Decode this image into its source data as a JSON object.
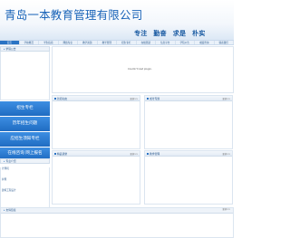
{
  "header": {
    "site_title": "青岛一本教育管理有限公司",
    "slogan": [
      "专注",
      "勤奋",
      "求是",
      "朴实"
    ]
  },
  "nav": {
    "items": [
      "首页",
      "学校概况",
      "学生指南",
      "网络专业",
      "教学资源",
      "教学管理",
      "招生专栏",
      "在线答疑",
      "信息平台",
      "学院公告",
      "成绩查询",
      "联系我们"
    ],
    "active_index": 0
  },
  "left": {
    "search_title": "学院公告",
    "buttons": [
      "招生专栏",
      "历年招生问题",
      "应招生须知专栏",
      "在线咨询   网上报名"
    ],
    "zone_title": "专业介绍",
    "zone_links": [
      "计算机",
      "",
      "护理",
      "",
      "建筑工程设计"
    ]
  },
  "main": {
    "notice_text": "Couldn't load plugin.",
    "boxes": [
      {
        "title": "新闻动态",
        "more": "更多>>"
      },
      {
        "title": "成考专题",
        "more": "更多>>"
      },
      {
        "title": "精品课堂",
        "more": "更多>>"
      },
      {
        "title": "教学管理",
        "more": "更多>>"
      }
    ]
  },
  "bottom": {
    "links_title": "友情链接",
    "more": "更多>>"
  },
  "colors": {
    "brand_blue": "#1a64b8",
    "button_blue": "#2a73c4",
    "border": "#dbe5f0"
  }
}
